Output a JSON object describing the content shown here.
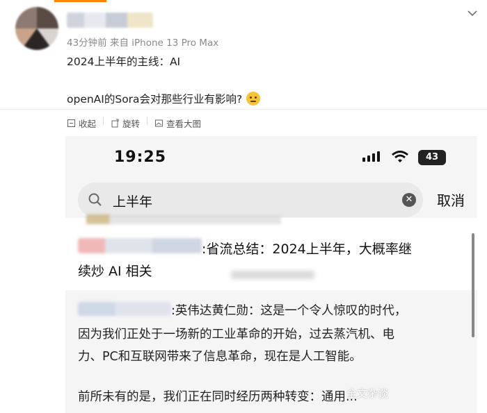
{
  "post": {
    "meta": "43分钟前 来自 iPhone 13 Pro Max",
    "line1": "2024上半年的主线：AI",
    "line2": "openAI的Sora会对那些行业有影响?"
  },
  "actions": {
    "collapse": "收起",
    "rotate": "旋转",
    "view_large": "查看大图"
  },
  "shot": {
    "time": "19:25",
    "battery": "43",
    "search_query": "上半年",
    "cancel": "取消",
    "result1_line1": ":省流总结：2024上半年，大概率继",
    "result1_line2": "续炒 AI 相关",
    "result2_line1": ":英伟达黄仁勋：这是一个令人惊叹的时代，",
    "result2_line2": "因为我们正处于一场新的工业革命的开始，过去蒸汽机、电",
    "result2_line3": "力、PC和互联网带来了信息革命，现在是人工智能。",
    "result2_line4": "前所未有的是，我们正在同时经历两种转变：通用...",
    "watermark": "全文杂谈"
  },
  "colors": {
    "accent": "#ff8200",
    "meta": "#8a8a8a"
  }
}
